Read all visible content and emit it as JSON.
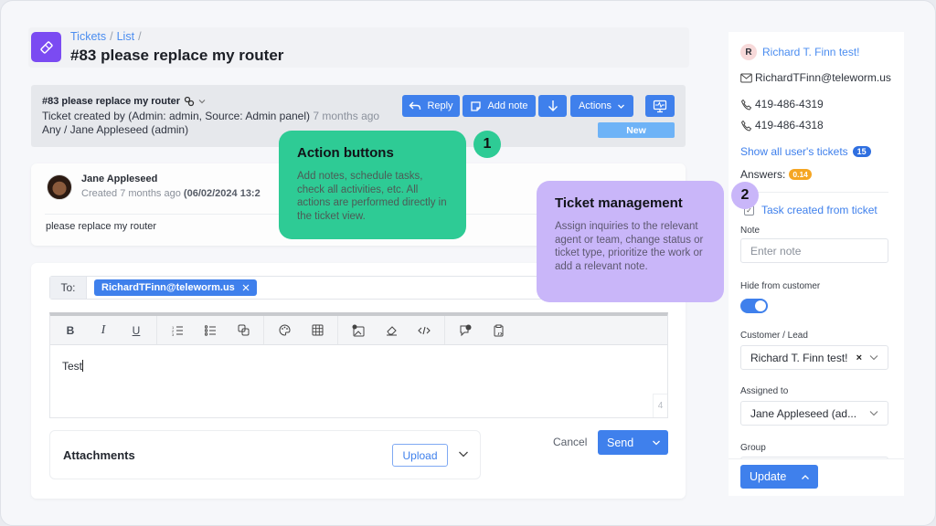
{
  "breadcrumb": {
    "items": [
      "Tickets",
      "List"
    ],
    "separator": "/"
  },
  "page": {
    "title": "#83 please replace my router",
    "icon": "ticket-icon"
  },
  "ticket_info": {
    "title": "#83 please replace my router",
    "created_by": "Ticket created by (Admin: admin, Source: Admin panel)",
    "created_ago": "7 months ago",
    "assignment": "Any / Jane Appleseed (admin)",
    "status": "New"
  },
  "actions": {
    "reply": "Reply",
    "add_note": "Add note",
    "actions_label": "Actions"
  },
  "message": {
    "author": "Jane Appleseed",
    "created_prefix": "Created 7 months ago",
    "created_date": "(06/02/2024 13:2",
    "body": "please replace my router"
  },
  "composer": {
    "to_label": "To:",
    "recipient": "RichardTFinn@teleworm.us",
    "toolbar": [
      "bold",
      "italic",
      "underline",
      "ordered-list",
      "bullet-list",
      "copy",
      "palette",
      "table",
      "image",
      "eraser",
      "code",
      "comment-check",
      "clipboard-code"
    ],
    "text": "Test",
    "char_count": "4",
    "attachments_title": "Attachments",
    "upload": "Upload",
    "cancel": "Cancel",
    "send": "Send"
  },
  "sidebar": {
    "customer_initial": "R",
    "customer_name": "Richard T. Finn test!",
    "email": "RichardTFinn@teleworm.us",
    "phones": [
      "419-486-4319",
      "419-486-4318"
    ],
    "show_tickets": "Show all user's tickets",
    "tickets_count": "15",
    "answers_label": "Answers:",
    "answers_value": "0.14",
    "task_label": "Task created from ticket",
    "task_checked": true,
    "note_label": "Note",
    "note_placeholder": "Enter note",
    "hide_label": "Hide from customer",
    "hide_enabled": true,
    "customer_label": "Customer / Lead",
    "customer_value": "Richard T. Finn test!",
    "assigned_label": "Assigned to",
    "assigned_value": "Jane Appleseed (ad...",
    "group_label": "Group",
    "update": "Update"
  },
  "callouts": [
    {
      "number": "1",
      "title": "Action buttons",
      "body": "Add notes, schedule tasks, check all activities, etc. All actions are performed directly in the ticket view.",
      "color": "#2ecb95"
    },
    {
      "number": "2",
      "title": "Ticket management",
      "body": "Assign inquiries to the relevant agent or team, change status or ticket type, prioritize the work or add a relevant note.",
      "color": "#c9b6f9"
    }
  ]
}
